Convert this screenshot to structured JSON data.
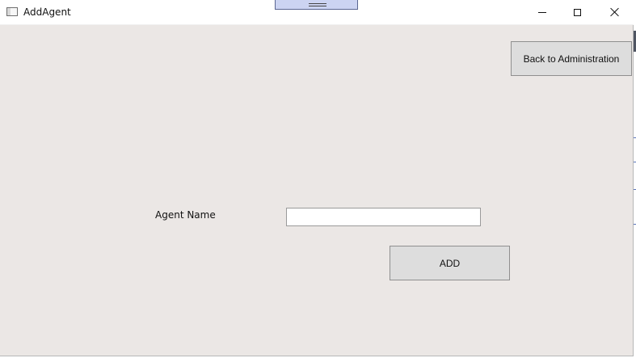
{
  "window": {
    "title": "AddAgent",
    "app_icon": "window-app-icon",
    "controls": {
      "minimize_icon": "minimize-icon",
      "maximize_icon": "maximize-icon",
      "close_icon": "close-icon"
    }
  },
  "navigation": {
    "back_label": "Back to Administration"
  },
  "form": {
    "agent_name_label": "Agent Name",
    "agent_name_value": "",
    "agent_name_placeholder": "",
    "add_label": "ADD"
  },
  "colors": {
    "window_background": "#ebe7e5",
    "title_bar": "#ffffff",
    "button_face": "#dddddd",
    "button_border": "#8f8f8f",
    "top_handle": "#ccd4f2"
  }
}
